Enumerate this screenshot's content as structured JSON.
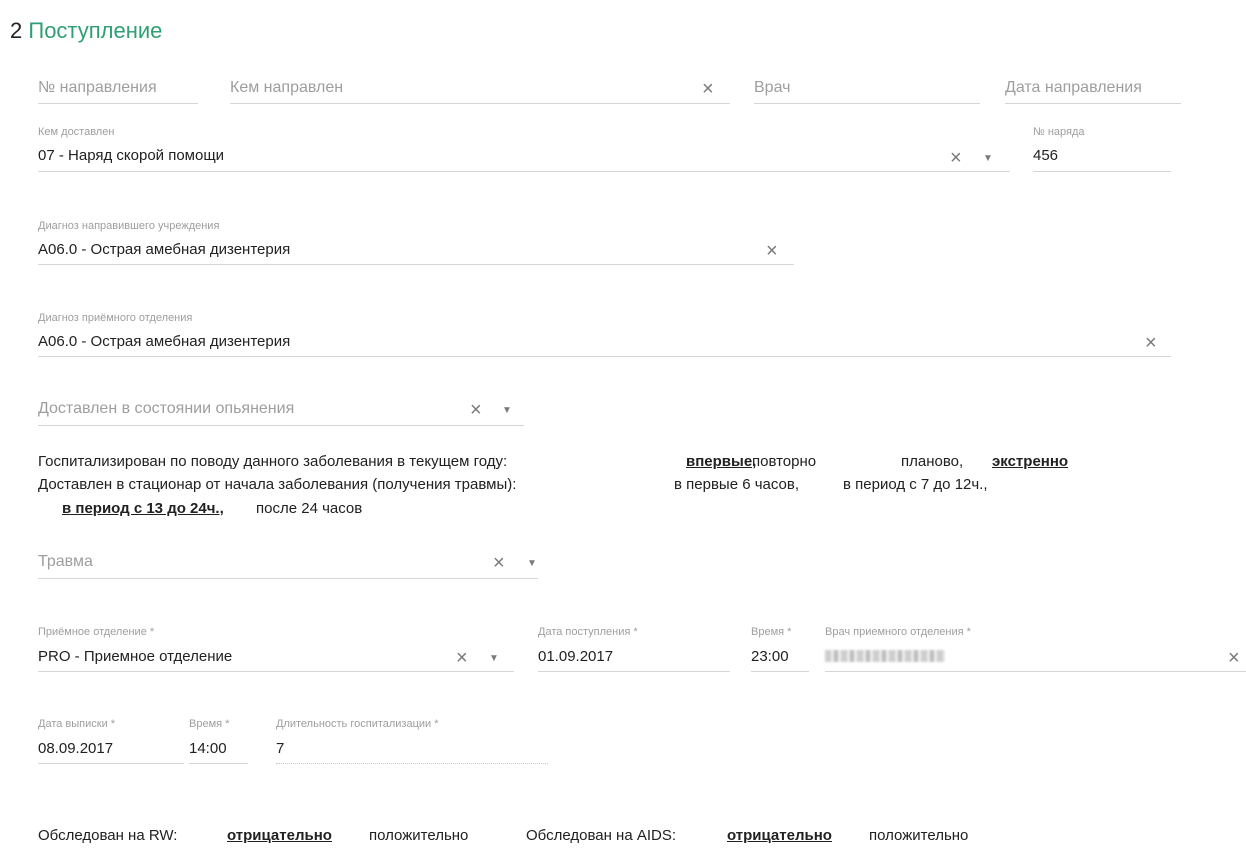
{
  "section": {
    "number": "2",
    "title": "Поступление"
  },
  "referral": {
    "number_placeholder": "№ направления",
    "by_placeholder": "Кем направлен",
    "doctor_placeholder": "Врач",
    "date_placeholder": "Дата направления"
  },
  "delivered_by": {
    "label": "Кем доставлен",
    "value": "07 - Наряд скорой помощи"
  },
  "team_number": {
    "label": "№ наряда",
    "value": "456"
  },
  "referring_diagnosis": {
    "label": "Диагноз направившего учреждения",
    "value": "A06.0 - Острая амебная дизентерия"
  },
  "admission_diagnosis": {
    "label": "Диагноз приёмного отделения",
    "value": "A06.0 - Острая амебная дизентерия"
  },
  "intoxication": {
    "placeholder": "Доставлен в состоянии опьянения"
  },
  "hospitalized": {
    "text": "Госпитализирован по поводу данного заболевания в текущем году:",
    "opt_first": "впервые,",
    "opt_repeat": "повторно",
    "opt_planned": "планово,",
    "opt_emergency": "экстренно"
  },
  "delivered_time": {
    "text": "Доставлен в стационар от начала заболевания (получения травмы):",
    "opt_6h": "в первые 6 часов,",
    "opt_7_12": "в период с 7 до 12ч.,",
    "opt_13_24": "в период с 13 до 24ч.,",
    "opt_24plus": "после 24 часов"
  },
  "trauma": {
    "placeholder": "Травма"
  },
  "admission_dept": {
    "label": "Приёмное отделение *",
    "value": "PRO - Приемное отделение"
  },
  "admission_date": {
    "label": "Дата поступления *",
    "value": "01.09.2017"
  },
  "admission_time": {
    "label": "Время *",
    "value": "23:00"
  },
  "admission_doctor": {
    "label": "Врач приемного отделения *"
  },
  "discharge_date": {
    "label": "Дата выписки *",
    "value": "08.09.2017"
  },
  "discharge_time": {
    "label": "Время *",
    "value": "14:00"
  },
  "duration": {
    "label": "Длительность госпитализации *",
    "value": "7"
  },
  "exams": {
    "rw_label": "Обследован на RW:",
    "rw_negative": "отрицательно",
    "rw_positive": "положительно",
    "aids_label": "Обследован на AIDS:",
    "aids_negative": "отрицательно",
    "aids_positive": "положительно"
  },
  "icons": {
    "clear": "close-icon",
    "dropdown": "caret-down-icon"
  },
  "colors": {
    "accent": "#2e9e74"
  }
}
